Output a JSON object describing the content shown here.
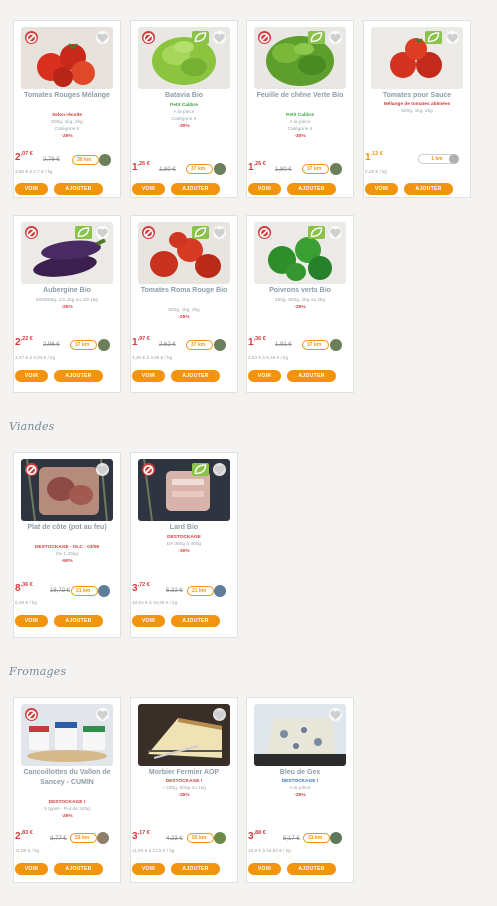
{
  "sections": {
    "viandes": "Viandes",
    "fromages": "Fromages"
  },
  "buttons": {
    "voir": "VOIR",
    "ajouter": "AJOUTER"
  },
  "colors": {
    "accent": "#f2940f",
    "promo": "#d23c3c",
    "bio": "#8bc34a",
    "title": "#8d9ea8"
  },
  "products": [
    {
      "name": "Tomates Rouges Mélange",
      "l1": "Selon récolte",
      "l2": "500g, 1kg, 2kg",
      "l3": "Catégorie II",
      "l4": "-25%",
      "pi": "2",
      "pd": ",07 €",
      "old": "2,76 €",
      "dist": "30 km",
      "unit": "3,60 € à 2,7 € / kg",
      "bio": false
    },
    {
      "name": "Batavia Bio",
      "l1": "Petit Calibre",
      "l2": "A la pièce",
      "l3": "Catégorie II",
      "l4": "-30%",
      "pi": "1",
      "pd": ",26 €",
      "old": "1,80 €",
      "dist": "37 km",
      "unit": "",
      "bio": true
    },
    {
      "name": "Feuille de chêne Verte Bio",
      "l1": "Petit Calibre",
      "l2": "A la pièce",
      "l3": "Catégorie II",
      "l4": "-30%",
      "pi": "1",
      "pd": ",26 €",
      "old": "1,80 €",
      "dist": "37 km",
      "unit": "",
      "bio": true
    },
    {
      "name": "Tomates pour Sauce",
      "l1": "Mélange de tomates abîmées",
      "l2": "500g, 1kg, 2kg",
      "l3": "",
      "l4": "",
      "pi": "1",
      "pd": ",12 €",
      "old": "",
      "dist": "1 km",
      "unit": "2,25 € / kg",
      "bio": true
    },
    {
      "name": "Aubergine Bio",
      "l1": "500/600g, 1/1,1kg ou 2/2,1kg",
      "l2": "-25%",
      "l3": "",
      "l4": "",
      "pi": "2",
      "pd": ",22 €",
      "old": "2,96 €",
      "dist": "37 km",
      "unit": "3,47 € à 4,04 € / kg",
      "bio": true
    },
    {
      "name": "Tomates Roma Rouge Bio",
      "l1": "500g, 1kg, 2kg",
      "l2": "-25%",
      "l3": "",
      "l4": "",
      "pi": "1",
      "pd": ",97 €",
      "old": "2,62 €",
      "dist": "37 km",
      "unit": "3,30 € à 3,95 € / kg",
      "bio": true
    },
    {
      "name": "Poivrons verts Bio",
      "l1": "250g, 500g, 1kg ou 2kg",
      "l2": "-25%",
      "l3": "",
      "l4": "",
      "pi": "1",
      "pd": ",36 €",
      "old": "1,81 €",
      "dist": "37 km",
      "unit": "2,54 € à 5,46 € / kg",
      "bio": true
    },
    {
      "name": "Plat de côte (pot au feu)",
      "l1": "DESTOCKAGE - DLC : 03/08",
      "l2": "De 1,25kg",
      "l3": "-50%",
      "l4": "",
      "pi": "8",
      "pd": ",36 €",
      "old": "16,72 €",
      "dist": "21 km",
      "unit": "6,48 € / kg",
      "bio": false
    },
    {
      "name": "Lard Bio",
      "l1": "DESTOCKAGE",
      "l2": "De 350g à 400g",
      "l3": "-30%",
      "l4": "",
      "pi": "3",
      "pd": ",72 €",
      "old": "5,32 €",
      "dist": "21 km",
      "unit": "10,64 € à 10,65 € / kg",
      "bio": true
    },
    {
      "name": "Cancoillottes du Vallon de Sancey - CUMIN",
      "l1": "DESTOCKAGE !",
      "l2": "5 types - Pot de 240g",
      "l3": "-25%",
      "l4": "",
      "pi": "2",
      "pd": ",83 €",
      "old": "3,77 €",
      "dist": "53 km",
      "unit": "11,80 € / kg",
      "bio": false
    },
    {
      "name": "Morbier Fermier AOP",
      "l1": "DESTOCKAGE !",
      "l2": "~ 250g, 500g ou 1kg",
      "l3": "-25%",
      "l4": "",
      "pi": "3",
      "pd": ",17 €",
      "old": "4,23 €",
      "dist": "55 km",
      "unit": "11,93 € à 12,6 € / kg",
      "bio": false
    },
    {
      "name": "Bleu de Gex",
      "l1": "DESTOCKAGE !",
      "l2": "A la pièce",
      "l3": "-25%",
      "l4": "",
      "pi": "3",
      "pd": ",88 €",
      "old": "5,17 €",
      "dist": "31 km",
      "unit": "16,8 € à 16,83 € / kg",
      "bio": false
    }
  ]
}
